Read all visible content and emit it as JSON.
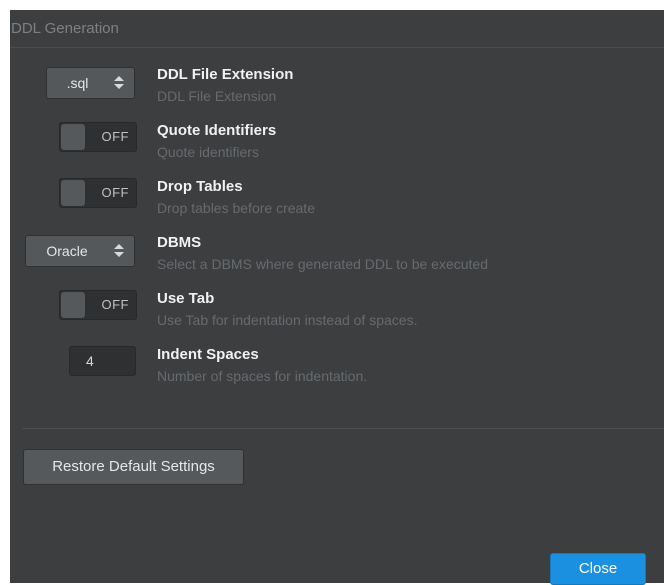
{
  "section": {
    "title": "DDL Generation"
  },
  "settings": [
    {
      "label": "DDL File Extension",
      "desc": "DDL File Extension",
      "control": "select",
      "value": ".sql"
    },
    {
      "label": "Quote Identifiers",
      "desc": "Quote identifiers",
      "control": "toggle",
      "value": "OFF"
    },
    {
      "label": "Drop Tables",
      "desc": "Drop tables before create",
      "control": "toggle",
      "value": "OFF"
    },
    {
      "label": "DBMS",
      "desc": "Select a DBMS where generated DDL to be executed",
      "control": "select",
      "value": "Oracle"
    },
    {
      "label": "Use Tab",
      "desc": "Use Tab for indentation instead of spaces.",
      "control": "toggle",
      "value": "OFF"
    },
    {
      "label": "Indent Spaces",
      "desc": "Number of spaces for indentation.",
      "control": "number",
      "value": "4"
    }
  ],
  "buttons": {
    "restore": "Restore Default Settings",
    "close": "Close"
  },
  "colors": {
    "background": "#3c3e40",
    "accent": "#1b8fe0"
  }
}
